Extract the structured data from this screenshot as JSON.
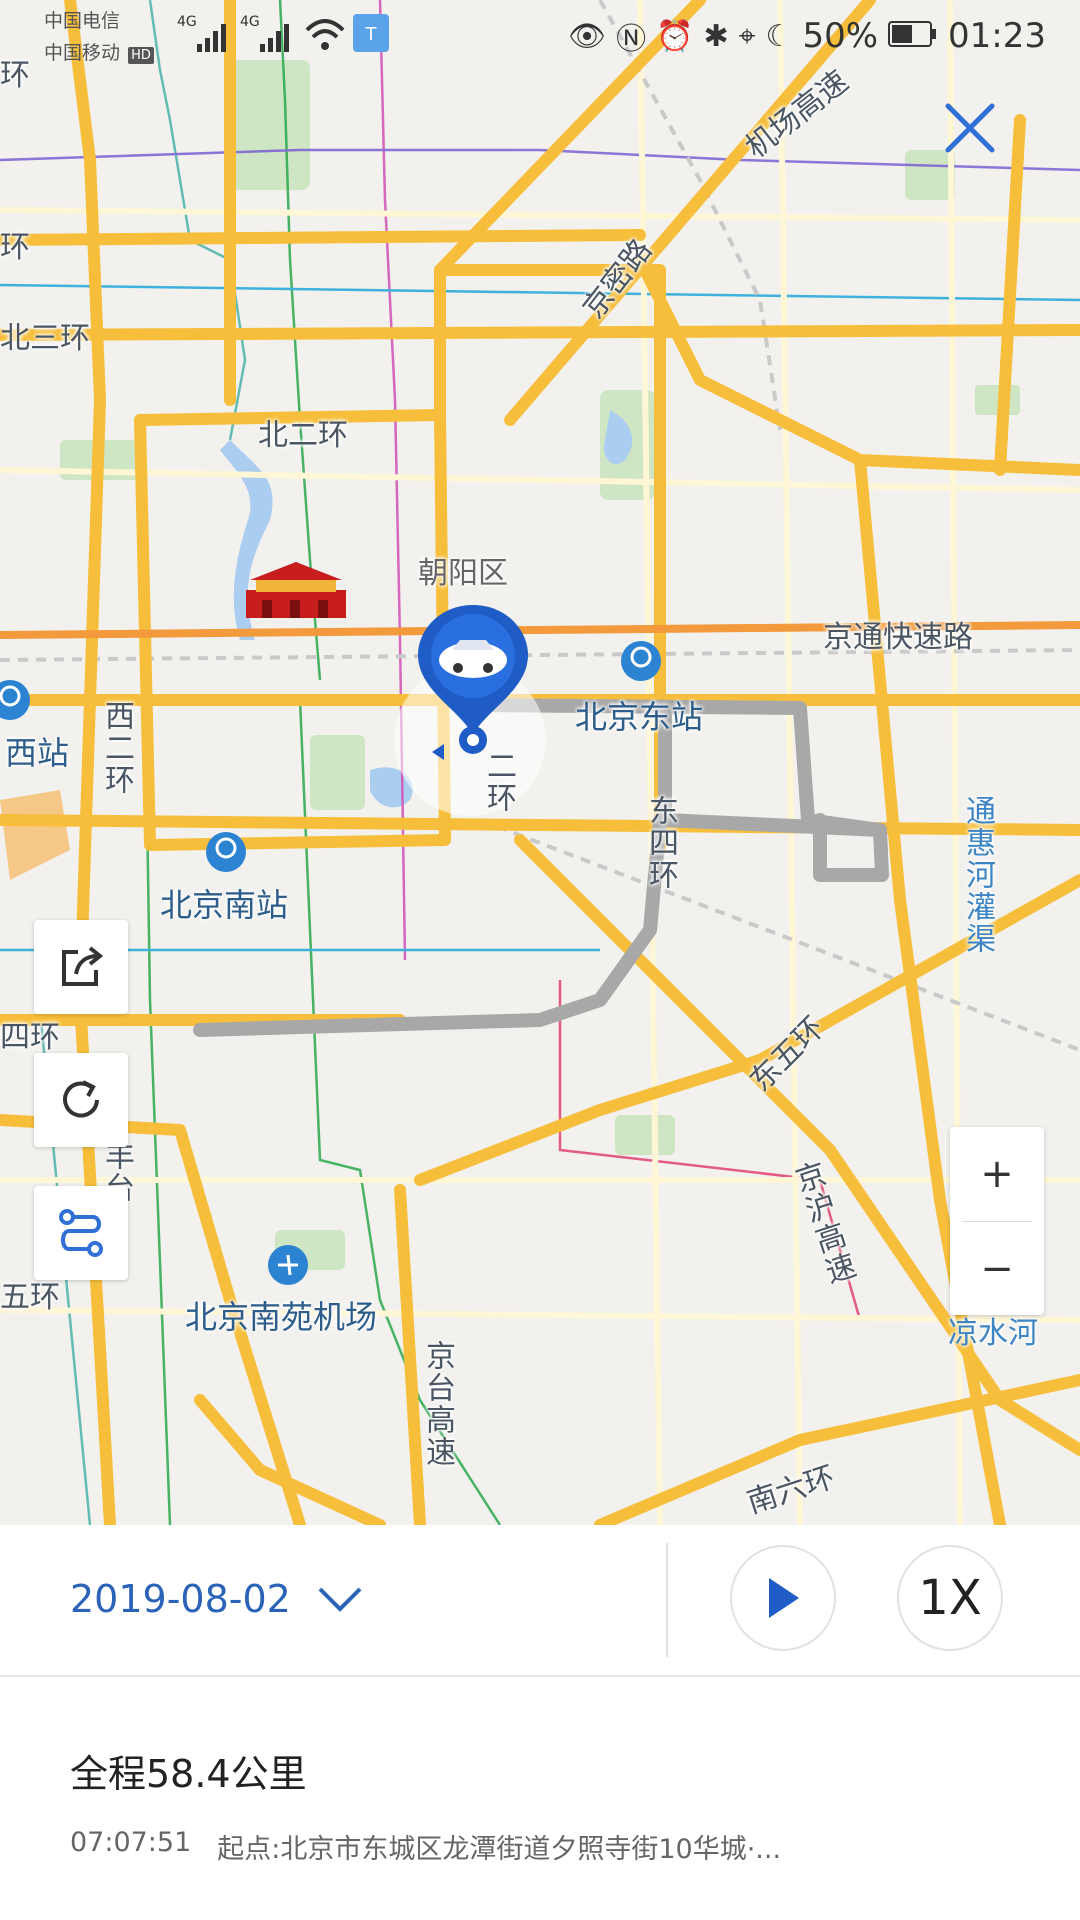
{
  "status_bar": {
    "carrier_1": "中国电信",
    "carrier_2": "中国移动",
    "hd_badge": "HD",
    "network_1": "4G",
    "network_2": "4G",
    "battery": "50%",
    "time": "01:23"
  },
  "map": {
    "labels": {
      "airport_expressway": "机场高速",
      "jingmi_road": "京密路",
      "north_3rd_ring": "北三环",
      "north_2nd_ring": "北二环",
      "huan_top_left": "环",
      "huan_left": "环",
      "chaoyang": "朝阳区",
      "jingtong_expressway": "京通快速路",
      "beijing_east_station": "北京东站",
      "west_station": "西站",
      "west_2nd_ring": "西二环",
      "second_ring_partial": "二环",
      "east_4th_ring": "东四环",
      "tonghui_river": "通惠河灌渠",
      "beijing_south_station": "北京南站",
      "west_4th_ring_partial": "四环",
      "east_5th_ring": "东五环",
      "jinghu_expressway": "京沪高速",
      "nanyuan_airport": "北京南苑机场",
      "west_5th_ring_partial": "五环",
      "jingtai_expressway": "京台高速",
      "liangshui_river": "凉水河",
      "south_6th_ring": "南六环",
      "fengtai_partial": "丰台"
    },
    "route_color": "#a8a8a8",
    "marker_color": "#1f5cc6"
  },
  "controls": {
    "share_icon": "share-icon",
    "refresh_icon": "refresh-icon",
    "route_icon": "route-icon",
    "zoom_in": "+",
    "zoom_out": "−"
  },
  "panel": {
    "date": "2019-08-02",
    "speed": "1X",
    "distance": "全程58.4公里",
    "start_time": "07:07:51",
    "start_address": "起点:北京市东城区龙潭街道夕照寺街10华城·..."
  },
  "colors": {
    "accent": "#2a63b8",
    "ring_road": "#f6be3a",
    "expressway": "#f3a629"
  }
}
